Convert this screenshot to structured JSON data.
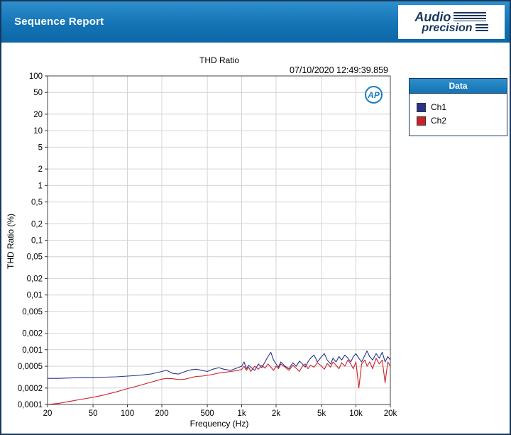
{
  "header": {
    "title": "Sequence Report",
    "brand": {
      "word1": "Audio",
      "word2": "precision"
    }
  },
  "chart": {
    "title": "THD Ratio",
    "timestamp": "07/10/2020 12:49:39.859",
    "xlabel": "Frequency (Hz)",
    "ylabel": "THD Ratio (%)",
    "ap_mark": "AP"
  },
  "legend": {
    "title": "Data",
    "items": [
      {
        "label": "Ch1",
        "color": "#27348b"
      },
      {
        "label": "Ch2",
        "color": "#cc2128"
      }
    ]
  },
  "colors": {
    "window_border": "#17375e",
    "header_blue": "#1474b5",
    "legend_header_blue": "#1878be",
    "grid": "#d4d4d4",
    "plot_border": "#444444"
  },
  "chart_data": {
    "type": "line",
    "title": "THD Ratio",
    "xlabel": "Frequency (Hz)",
    "ylabel": "THD Ratio (%)",
    "x_scale": "log",
    "y_scale": "log",
    "xlim": [
      20,
      20000
    ],
    "ylim": [
      0.0001,
      100
    ],
    "grid": true,
    "legend_position": "right",
    "x_ticks": [
      20,
      50,
      100,
      200,
      500,
      1000,
      2000,
      5000,
      10000,
      20000
    ],
    "x_tick_labels": [
      "20",
      "50",
      "100",
      "200",
      "500",
      "1k",
      "2k",
      "5k",
      "10k",
      "20k"
    ],
    "y_ticks": [
      100,
      50,
      20,
      10,
      5,
      2,
      1,
      0.5,
      0.2,
      0.1,
      0.05,
      0.02,
      0.01,
      0.005,
      0.002,
      0.001,
      0.0005,
      0.0002,
      0.0001
    ],
    "y_tick_labels": [
      "100",
      "50",
      "20",
      "10",
      "5",
      "2",
      "1",
      "0,5",
      "0,2",
      "0,1",
      "0,05",
      "0,02",
      "0,01",
      "0,005",
      "0,002",
      "0,001",
      "0,0005",
      "0,0002",
      "0,0001"
    ],
    "x": [
      20,
      25,
      32,
      40,
      50,
      63,
      80,
      100,
      125,
      160,
      200,
      220,
      250,
      280,
      320,
      360,
      400,
      450,
      500,
      560,
      630,
      700,
      800,
      900,
      1000,
      1050,
      1100,
      1150,
      1200,
      1300,
      1400,
      1500,
      1600,
      1700,
      1800,
      1900,
      2000,
      2100,
      2200,
      2400,
      2600,
      2800,
      3000,
      3200,
      3400,
      3600,
      3800,
      4000,
      4300,
      4600,
      5000,
      5300,
      5600,
      6000,
      6300,
      6700,
      7100,
      7500,
      8000,
      8500,
      9000,
      9500,
      10000,
      10600,
      11200,
      12000,
      12500,
      13200,
      14000,
      15000,
      16000,
      17000,
      18000,
      19000,
      20000
    ],
    "series": [
      {
        "name": "Ch1",
        "color": "#27348b",
        "values": [
          0.0003,
          0.0003,
          0.000305,
          0.00031,
          0.00031,
          0.000315,
          0.00032,
          0.00033,
          0.00034,
          0.00036,
          0.0004,
          0.00042,
          0.00037,
          0.00036,
          0.0004,
          0.00043,
          0.00044,
          0.00042,
          0.0004,
          0.00044,
          0.00047,
          0.00044,
          0.00042,
          0.00046,
          0.0005,
          0.0006,
          0.00045,
          0.00052,
          0.00048,
          0.00042,
          0.00055,
          0.00047,
          0.0006,
          0.00075,
          0.0009,
          0.00065,
          0.00055,
          0.00048,
          0.0006,
          0.0005,
          0.00045,
          0.00058,
          0.0005,
          0.00062,
          0.00055,
          0.00048,
          0.0006,
          0.0007,
          0.0008,
          0.0006,
          0.00075,
          0.00085,
          0.00065,
          0.00055,
          0.0007,
          0.0006,
          0.00075,
          0.00065,
          0.0008,
          0.0007,
          0.0006,
          0.00075,
          0.00085,
          0.0007,
          0.0006,
          0.0008,
          0.00095,
          0.00075,
          0.00065,
          0.00085,
          0.0007,
          0.0009,
          0.0006,
          0.00075,
          0.00065
        ]
      },
      {
        "name": "Ch2",
        "color": "#cc2128",
        "values": [
          0.0001,
          0.000105,
          0.000115,
          0.000125,
          0.000135,
          0.00015,
          0.00017,
          0.000195,
          0.00022,
          0.000255,
          0.00029,
          0.0003,
          0.000295,
          0.000285,
          0.00029,
          0.00031,
          0.000325,
          0.00033,
          0.00034,
          0.000355,
          0.000375,
          0.000385,
          0.0004,
          0.000415,
          0.000435,
          0.0005,
          0.00042,
          0.00048,
          0.0004,
          0.0005,
          0.00044,
          0.00052,
          0.00046,
          0.00055,
          0.00048,
          0.00042,
          0.0005,
          0.00045,
          0.00055,
          0.00048,
          0.00042,
          0.00052,
          0.00046,
          0.0004,
          0.0005,
          0.00055,
          0.00045,
          0.00052,
          0.00048,
          0.00058,
          0.0005,
          0.00044,
          0.00056,
          0.00048,
          0.0006,
          0.00052,
          0.00045,
          0.00058,
          0.0005,
          0.00065,
          0.00055,
          0.00045,
          0.0006,
          0.0002,
          0.00055,
          0.00065,
          0.0005,
          0.0006,
          0.00045,
          0.0007,
          0.00055,
          0.00065,
          0.00025,
          0.0006,
          0.0005
        ]
      }
    ]
  }
}
